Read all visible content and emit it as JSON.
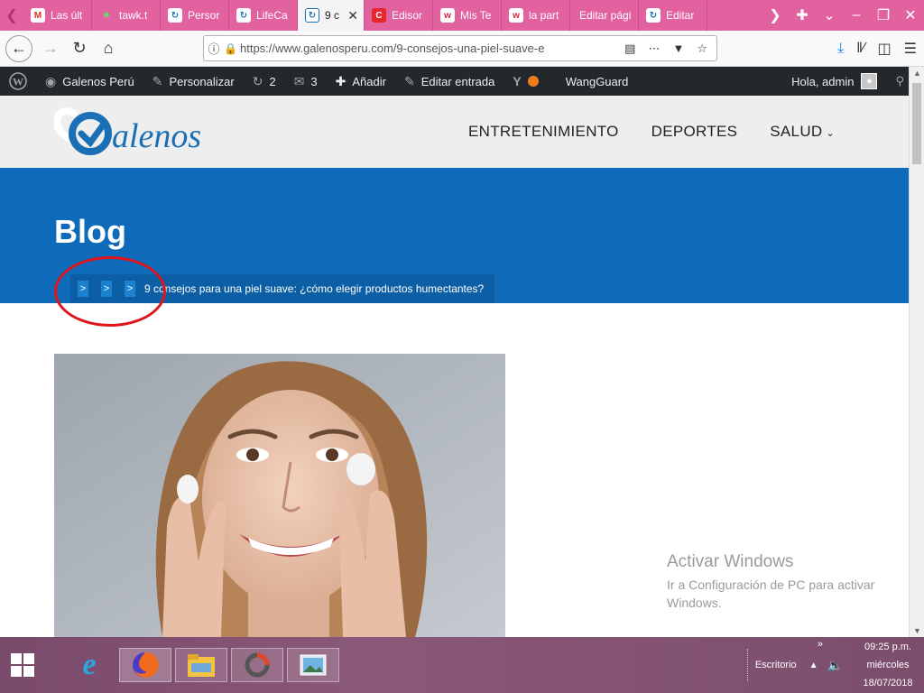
{
  "browser": {
    "tabs": [
      {
        "label": "Las últ",
        "favicon": "gmail-icon"
      },
      {
        "label": "tawk.t",
        "favicon": "tawk-icon"
      },
      {
        "label": "Persor",
        "favicon": "wp-icon"
      },
      {
        "label": "LifeCa",
        "favicon": "wp-icon"
      },
      {
        "label": "9 c",
        "favicon": "wp-icon",
        "active": true
      },
      {
        "label": "Edisor",
        "favicon": "c-icon"
      },
      {
        "label": "Mis Te",
        "favicon": "w-icon"
      },
      {
        "label": "la part",
        "favicon": "w-icon"
      },
      {
        "label": "Editar pági",
        "favicon": ""
      },
      {
        "label": "Editar",
        "favicon": "wp-icon"
      }
    ],
    "url": "https://www.galenosperu.com/9-consejos-una-piel-suave-e"
  },
  "wp_admin_bar": {
    "site_name": "Galenos Perú",
    "customize": "Personalizar",
    "updates_count": "2",
    "comments_count": "3",
    "add_new": "Añadir",
    "edit_post": "Editar entrada",
    "wangguard": "WangGuard",
    "greeting": "Hola, admin"
  },
  "site": {
    "logo_text": "alenos",
    "nav": [
      {
        "label": "ENTRETENIMIENTO"
      },
      {
        "label": "DEPORTES"
      },
      {
        "label": "SALUD",
        "has_dropdown": true
      }
    ],
    "hero_title": "Blog",
    "breadcrumb": {
      "separators": [
        ">",
        ">",
        ">"
      ],
      "current": "9 consejos para una piel suave: ¿cómo elegir productos humectantes?"
    }
  },
  "watermark": {
    "title": "Activar Windows",
    "subtitle": "Ir a Configuración de PC para activar Windows."
  },
  "taskbar": {
    "desktop_label": "Escritorio",
    "time": "09:25 p.m.",
    "day": "miércoles",
    "date": "18/07/2018",
    "chevron": "»"
  },
  "colors": {
    "tabstrip": "#e2619f",
    "wp_bar": "#23282d",
    "hero_blue": "#0f6bba",
    "brand_blue": "#1a6fb5",
    "annotation_red": "#e0141a"
  }
}
